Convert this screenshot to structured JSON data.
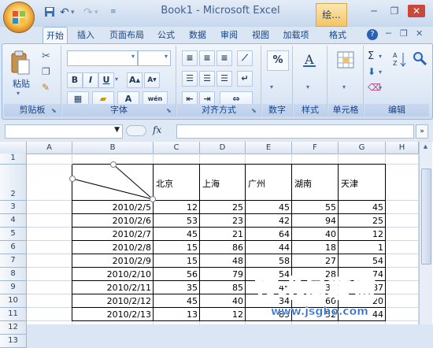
{
  "window": {
    "title": "Book1 - Microsoft Excel",
    "context_tab": "绘..."
  },
  "ribbon_tabs": [
    "开始",
    "插入",
    "页面布局",
    "公式",
    "数据",
    "审阅",
    "视图",
    "加载项",
    "格式"
  ],
  "active_tab": "开始",
  "groups": {
    "clipboard": {
      "label": "剪贴板",
      "paste_label": "粘贴"
    },
    "font": {
      "label": "字体",
      "bold": "B",
      "italic": "I",
      "underline": "U",
      "font_color_letter": "A",
      "fill_letter": "A",
      "wen": "wén"
    },
    "alignment": {
      "label": "对齐方式"
    },
    "number": {
      "label": "数字",
      "symbol": "%"
    },
    "styles": {
      "label": "样式"
    },
    "cells": {
      "label": "单元格"
    },
    "editing": {
      "label": "编辑",
      "sum": "Σ"
    }
  },
  "formula_bar": {
    "fx": "fx",
    "name_value": "",
    "formula_value": ""
  },
  "columns": [
    "A",
    "B",
    "C",
    "D",
    "E",
    "F",
    "G",
    "H"
  ],
  "rows": [
    "1",
    "2",
    "3",
    "4",
    "5",
    "6",
    "7",
    "8",
    "9",
    "10",
    "11",
    "12",
    "13"
  ],
  "table": {
    "headers": [
      "北京",
      "上海",
      "广州",
      "湖南",
      "天津"
    ],
    "dates": [
      "2010/2/5",
      "2010/2/6",
      "2010/2/7",
      "2010/2/8",
      "2010/2/9",
      "2010/2/10",
      "2010/2/11",
      "2010/2/12",
      "2010/2/13"
    ],
    "values": [
      [
        12,
        25,
        45,
        55,
        45
      ],
      [
        53,
        23,
        42,
        94,
        25
      ],
      [
        45,
        21,
        64,
        40,
        12
      ],
      [
        15,
        86,
        44,
        18,
        1
      ],
      [
        15,
        48,
        58,
        27,
        54
      ],
      [
        56,
        79,
        54,
        28,
        74
      ],
      [
        35,
        85,
        45,
        30,
        87
      ],
      [
        45,
        40,
        34,
        60,
        20
      ],
      [
        13,
        12,
        85,
        52,
        44
      ]
    ]
  },
  "watermark": {
    "text": "技术员联盟",
    "url": "www.jsgho.com"
  },
  "colors": {
    "accent": "#15428b",
    "ribbon": "#dde8f6",
    "grid": "#d0d7e5"
  }
}
